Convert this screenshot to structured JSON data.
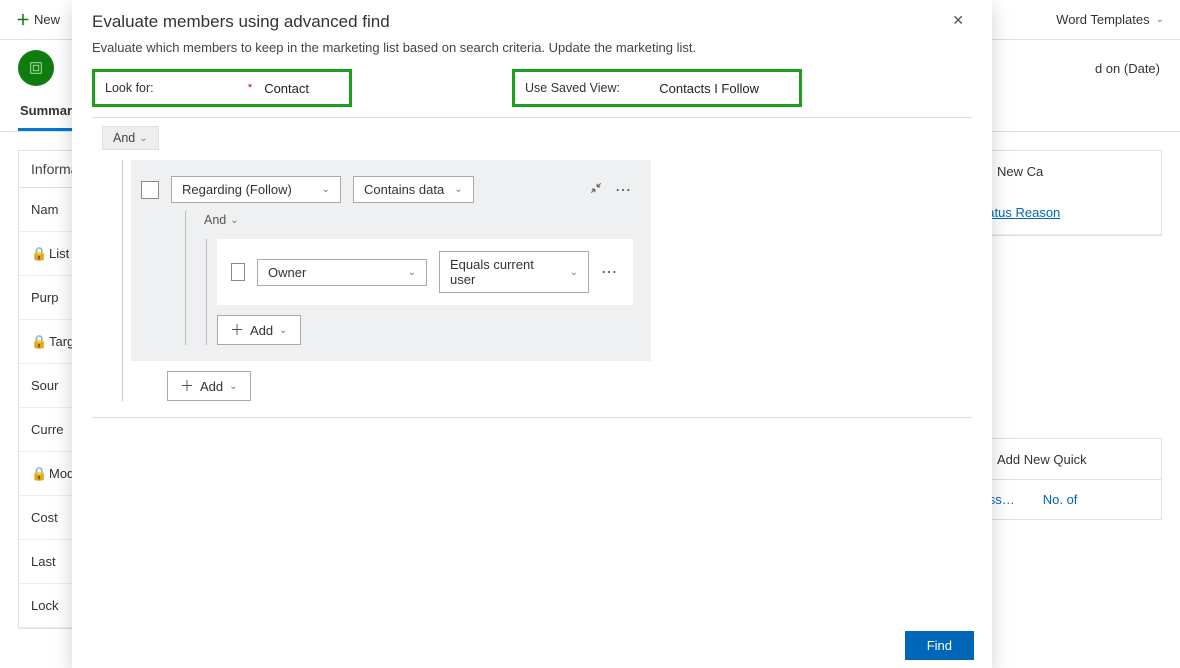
{
  "topbar": {
    "new_label": "New",
    "word_templates_label": "Word Templates"
  },
  "record_header": {
    "right_label": "d on (Date)"
  },
  "tabs": {
    "summary": "Summary"
  },
  "left_section": {
    "title": "Informa",
    "rows": {
      "name": "Nam",
      "list_type": "List T",
      "purpose": "Purp",
      "targeted": "Targe",
      "source": "Sour",
      "currency": "Curre",
      "modified": "Mod",
      "cost": "Cost",
      "last": "Last",
      "locked": "Lock"
    }
  },
  "right_col": {
    "new_ca": "New Ca",
    "status_reason": "Status Reason",
    "add_new_quick": "Add New Quick",
    "cess": "cess…",
    "no_of": "No. of "
  },
  "modal": {
    "title": "Evaluate members using advanced find",
    "subtitle": "Evaluate which members to keep in the marketing list based on search criteria. Update the marketing list.",
    "look_for_label": "Look for:",
    "look_for_value": "Contact",
    "saved_view_label": "Use Saved View:",
    "saved_view_value": "Contacts I Follow",
    "and": "And",
    "regarding": "Regarding (Follow)",
    "contains_data": "Contains data",
    "owner": "Owner",
    "equals_current_user": "Equals current user",
    "add": "Add",
    "find": "Find"
  }
}
